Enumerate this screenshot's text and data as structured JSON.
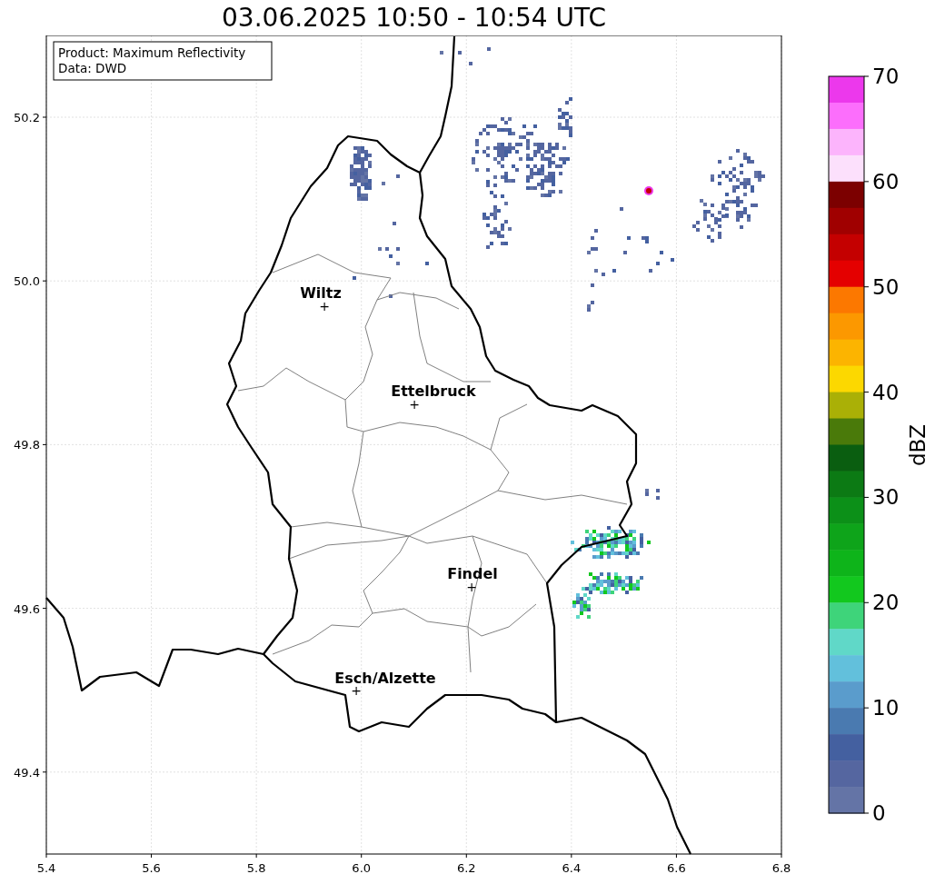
{
  "title": "03.06.2025 10:50 - 10:54 UTC",
  "info_box": [
    "Product: Maximum Reflectivity",
    "Data: DWD"
  ],
  "x_ticks": [
    "5.4",
    "5.6",
    "5.8",
    "6.0",
    "6.2",
    "6.4",
    "6.6",
    "6.8"
  ],
  "y_ticks": [
    "50.2",
    "50.0",
    "49.8",
    "49.6",
    "49.4"
  ],
  "cities": [
    {
      "name": "Wiltz",
      "marker": "+"
    },
    {
      "name": "Ettelbruck",
      "marker": "+"
    },
    {
      "name": "Findel",
      "marker": "+"
    },
    {
      "name": "Esch/Alzette",
      "marker": "+"
    }
  ],
  "colorbar": {
    "label": "dBZ",
    "ticks": [
      "70",
      "60",
      "50",
      "40",
      "30",
      "20",
      "10",
      "0"
    ],
    "bins": [
      {
        "color": "#ec38ec"
      },
      {
        "color": "#fc6efc"
      },
      {
        "color": "#fcb4fc"
      },
      {
        "color": "#fce0fc"
      },
      {
        "color": "#7c0000"
      },
      {
        "color": "#a00000"
      },
      {
        "color": "#c40000"
      },
      {
        "color": "#e40000"
      },
      {
        "color": "#fc7800"
      },
      {
        "color": "#fc9800"
      },
      {
        "color": "#fcb400"
      },
      {
        "color": "#fcd800"
      },
      {
        "color": "#aab006"
      },
      {
        "color": "#4a7a0a"
      },
      {
        "color": "#0a5e10"
      },
      {
        "color": "#0c7a14"
      },
      {
        "color": "#0c9018"
      },
      {
        "color": "#0ea41a"
      },
      {
        "color": "#0eb41a"
      },
      {
        "color": "#12c81e"
      },
      {
        "color": "#3ed47a"
      },
      {
        "color": "#60d8c8"
      },
      {
        "color": "#62c0dc"
      },
      {
        "color": "#5a9ccc"
      },
      {
        "color": "#4a7ab0"
      },
      {
        "color": "#4460a0"
      },
      {
        "color": "#5566a0"
      },
      {
        "color": "#6474a6"
      }
    ]
  }
}
